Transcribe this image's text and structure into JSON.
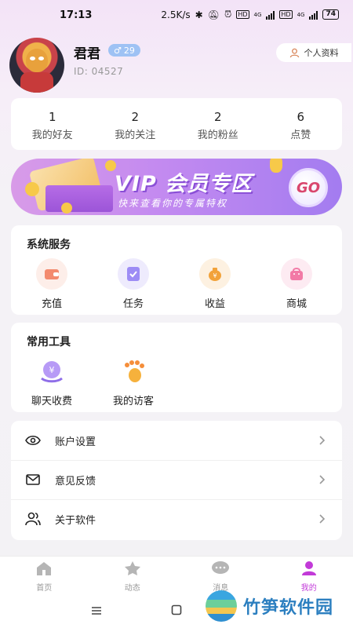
{
  "status_bar": {
    "time": "17:13",
    "speed": "2.5K/s",
    "battery": "74",
    "net1": "4G",
    "net2": "4G"
  },
  "profile": {
    "name": "君君",
    "gender_symbol": "♂",
    "age": "29",
    "id_text": "ID: 04527",
    "profile_button": "个人资料"
  },
  "stats": [
    {
      "value": "1",
      "label": "我的好友"
    },
    {
      "value": "2",
      "label": "我的关注"
    },
    {
      "value": "2",
      "label": "我的粉丝"
    },
    {
      "value": "6",
      "label": "点赞"
    }
  ],
  "vip": {
    "title": "VIP 会员专区",
    "subtitle": "快来查看你的专属特权",
    "go": "GO"
  },
  "system_services": {
    "title": "系统服务",
    "items": [
      {
        "label": "充值",
        "icon": "wallet-icon",
        "color": "#f38a6e"
      },
      {
        "label": "任务",
        "icon": "task-icon",
        "color": "#9d8cf5"
      },
      {
        "label": "收益",
        "icon": "money-bag-icon",
        "color": "#f2a23a"
      },
      {
        "label": "商城",
        "icon": "shop-icon",
        "color": "#f27aa6"
      }
    ]
  },
  "tools": {
    "title": "常用工具",
    "items": [
      {
        "label": "聊天收费",
        "icon": "chat-fee-icon",
        "color": "#a47ef0"
      },
      {
        "label": "我的访客",
        "icon": "footprint-icon",
        "color": "#f6b13c"
      }
    ]
  },
  "settings": [
    {
      "label": "账户设置",
      "icon": "eye-icon"
    },
    {
      "label": "意见反馈",
      "icon": "mail-icon"
    },
    {
      "label": "关于软件",
      "icon": "users-icon"
    }
  ],
  "tabs": [
    {
      "label": "首页",
      "icon": "home-icon"
    },
    {
      "label": "动态",
      "icon": "star-icon"
    },
    {
      "label": "消息",
      "icon": "message-icon"
    },
    {
      "label": "我的",
      "icon": "user-icon",
      "active": true
    }
  ],
  "watermark": "竹笋软件园",
  "colors": {
    "accent": "#c23ad8",
    "vip_start": "#d89be8",
    "vip_end": "#a37cf0"
  }
}
